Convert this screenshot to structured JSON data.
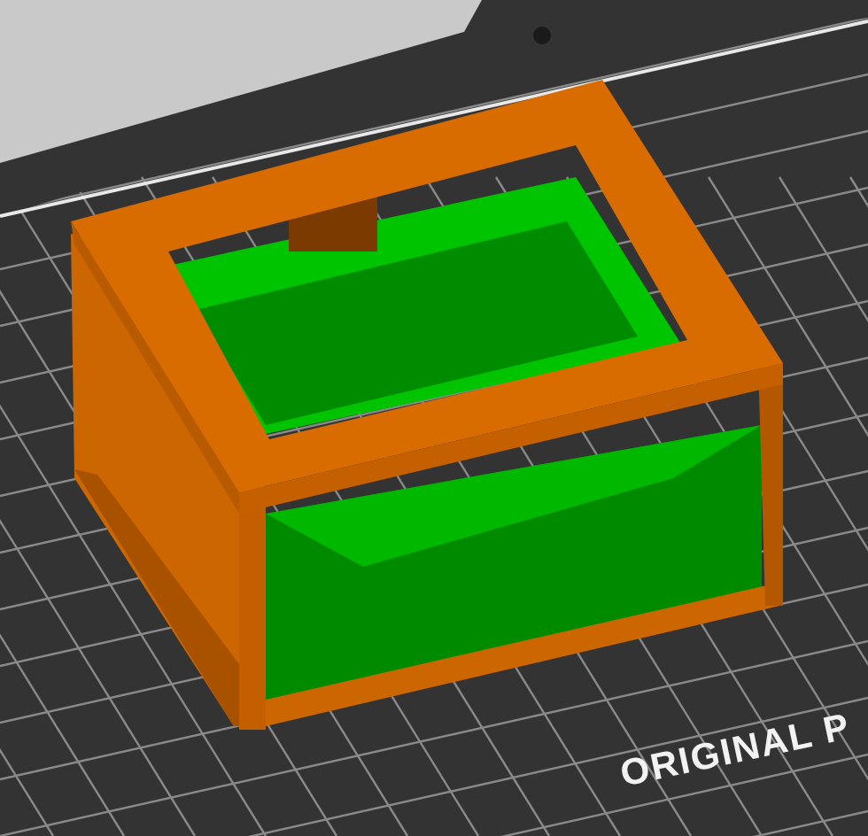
{
  "viewport": {
    "bed_label": "ORIGINAL P"
  }
}
